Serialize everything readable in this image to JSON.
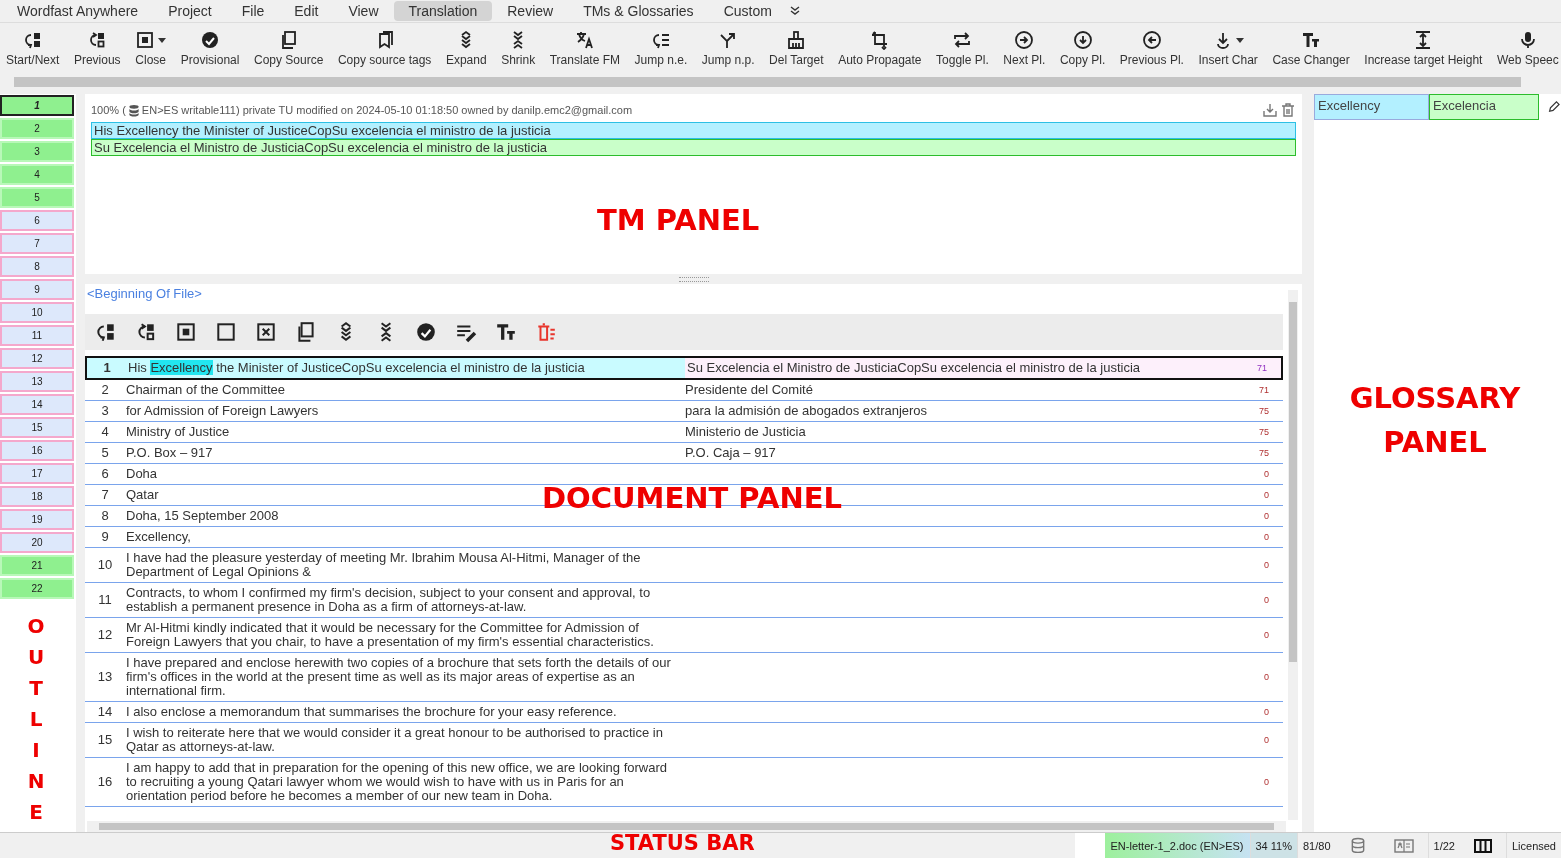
{
  "menu": [
    {
      "label": "Wordfast Anywhere",
      "selected": false
    },
    {
      "label": "Project",
      "selected": false
    },
    {
      "label": "File",
      "selected": false
    },
    {
      "label": "Edit",
      "selected": false
    },
    {
      "label": "View",
      "selected": false
    },
    {
      "label": "Translation",
      "selected": true
    },
    {
      "label": "Review",
      "selected": false
    },
    {
      "label": "TMs & Glossaries",
      "selected": false
    },
    {
      "label": "Custom",
      "selected": false
    }
  ],
  "toolbar": [
    {
      "label": "Start/Next",
      "dropdown": false
    },
    {
      "label": "Previous",
      "dropdown": false
    },
    {
      "label": "Close",
      "dropdown": true
    },
    {
      "label": "Provisional",
      "dropdown": false
    },
    {
      "label": "Copy Source",
      "dropdown": false
    },
    {
      "label": "Copy source tags",
      "dropdown": false
    },
    {
      "label": "Expand",
      "dropdown": false
    },
    {
      "label": "Shrink",
      "dropdown": false
    },
    {
      "label": "Translate FM",
      "dropdown": false
    },
    {
      "label": "Jump n.e.",
      "dropdown": false
    },
    {
      "label": "Jump n.p.",
      "dropdown": false
    },
    {
      "label": "Del Target",
      "dropdown": false
    },
    {
      "label": "Auto Propagate",
      "dropdown": false
    },
    {
      "label": "Toggle Pl.",
      "dropdown": false
    },
    {
      "label": "Next Pl.",
      "dropdown": false
    },
    {
      "label": "Copy Pl.",
      "dropdown": false
    },
    {
      "label": "Previous Pl.",
      "dropdown": false
    },
    {
      "label": "Insert Char",
      "dropdown": true
    },
    {
      "label": "Case Changer",
      "dropdown": false
    },
    {
      "label": "Increase target Height",
      "dropdown": false
    },
    {
      "label": "Web Speec",
      "dropdown": false
    }
  ],
  "outline": [
    {
      "number": "1",
      "translated": true,
      "selected": true
    },
    {
      "number": "2",
      "translated": true,
      "selected": false
    },
    {
      "number": "3",
      "translated": true,
      "selected": false
    },
    {
      "number": "4",
      "translated": true,
      "selected": false
    },
    {
      "number": "5",
      "translated": true,
      "selected": false
    },
    {
      "number": "6",
      "translated": false,
      "selected": false
    },
    {
      "number": "7",
      "translated": false,
      "selected": false
    },
    {
      "number": "8",
      "translated": false,
      "selected": false
    },
    {
      "number": "9",
      "translated": false,
      "selected": false
    },
    {
      "number": "10",
      "translated": false,
      "selected": false
    },
    {
      "number": "11",
      "translated": false,
      "selected": false
    },
    {
      "number": "12",
      "translated": false,
      "selected": false
    },
    {
      "number": "13",
      "translated": false,
      "selected": false
    },
    {
      "number": "14",
      "translated": false,
      "selected": false
    },
    {
      "number": "15",
      "translated": false,
      "selected": false
    },
    {
      "number": "16",
      "translated": false,
      "selected": false
    },
    {
      "number": "17",
      "translated": false,
      "selected": false
    },
    {
      "number": "18",
      "translated": false,
      "selected": false
    },
    {
      "number": "19",
      "translated": false,
      "selected": false
    },
    {
      "number": "20",
      "translated": false,
      "selected": false
    },
    {
      "number": "21",
      "translated": true,
      "selected": false
    },
    {
      "number": "22",
      "translated": true,
      "selected": false
    }
  ],
  "tm_panel": {
    "match_prefix": "100% (",
    "match_info": "EN>ES writable111) private TU modified on 2024-05-10 01:18:50 owned by danilp.emc2@gmail.com",
    "source": "His Excellency the Minister of JusticeCopSu excelencia el ministro de la justicia",
    "target": "Su Excelencia el Ministro de JusticiaCopSu excelencia el ministro de la justicia"
  },
  "document": {
    "beginning_marker": "<Beginning Of File>",
    "segments": [
      {
        "number": "1",
        "source_parts": [
          {
            "text": "His ",
            "highlighted": false
          },
          {
            "text": "Excellency",
            "highlighted": true
          },
          {
            "text": " the Minister of JusticeCopSu excelencia el ministro de la justicia",
            "highlighted": false
          }
        ],
        "target": "Su Excelencia el Ministro de JusticiaCopSu excelencia el ministro de la justicia",
        "score": "71",
        "selected": true
      },
      {
        "number": "2",
        "source": "Chairman of the Committee",
        "target": "Presidente del Comité",
        "score": "71",
        "selected": false
      },
      {
        "number": "3",
        "source": "for Admission of Foreign Lawyers",
        "target": "para la admisión de abogados extranjeros",
        "score": "75",
        "selected": false
      },
      {
        "number": "4",
        "source": "Ministry of Justice",
        "target": "Ministerio de Justicia",
        "score": "75",
        "selected": false
      },
      {
        "number": "5",
        "source": "P.O. Box – 917",
        "target": "P.O. Caja – 917",
        "score": "75",
        "selected": false
      },
      {
        "number": "6",
        "source": "Doha",
        "score": "0",
        "selected": false
      },
      {
        "number": "7",
        "source": "Qatar",
        "score": "0",
        "selected": false
      },
      {
        "number": "8",
        "source": "Doha, 15 September 2008",
        "score": "0",
        "selected": false
      },
      {
        "number": "9",
        "source": "Excellency,",
        "score": "0",
        "selected": false
      },
      {
        "number": "10",
        "source": "I have had the pleasure yesterday of meeting Mr. Ibrahim Mousa Al-Hitmi, Manager of the Department of Legal Opinions &",
        "score": "0",
        "selected": false
      },
      {
        "number": "11",
        "source": "Contracts, to whom I confirmed my firm's decision, subject to your consent and approval, to establish a permanent presence in Doha as a firm of attorneys-at-law.",
        "score": "0",
        "selected": false
      },
      {
        "number": "12",
        "source": "Mr Al-Hitmi kindly indicated that it would be necessary for the Committee for Admission of Foreign Lawyers that you chair, to have a presentation of my firm's essential characteristics.",
        "score": "0",
        "selected": false
      },
      {
        "number": "13",
        "source": "I have prepared and enclose herewith two copies of a brochure that sets forth the details of our firm's offices in the world at the present time as well as its major areas of expertise as an international firm.",
        "score": "0",
        "selected": false
      },
      {
        "number": "14",
        "source": "I also enclose a memorandum that summarises the brochure for your easy reference.",
        "score": "0",
        "selected": false
      },
      {
        "number": "15",
        "source": "I wish to reiterate here that we would consider it a great honour to be authorised to practice in Qatar as attorneys-at-law.",
        "score": "0",
        "selected": false
      },
      {
        "number": "16",
        "source": "I am happy to add that in preparation for the opening of this new office, we are looking forward to recruiting a young Qatari lawyer whom we would wish to have with us in Paris for an orientation period before he becomes a member of our new team in Doha.",
        "score": "0",
        "selected": false
      }
    ]
  },
  "glossary": {
    "entries": [
      {
        "source": "Excellency",
        "target": "Excelencia"
      }
    ]
  },
  "status_bar": {
    "file": "EN-letter-1_2.doc (EN>ES)",
    "progress": "34 11%",
    "count": "81/80",
    "segment": "1/22",
    "license": "Licensed"
  },
  "annotations": [
    {
      "text": "TM PANEL",
      "kind": "tm"
    },
    {
      "text": "DOCUMENT PANEL",
      "kind": "document"
    },
    {
      "text": "GLOSSARY PANEL",
      "kind": "glossary"
    },
    {
      "text": "OUTLINE",
      "kind": "outline"
    },
    {
      "text": "STATUS BAR",
      "kind": "status"
    }
  ]
}
